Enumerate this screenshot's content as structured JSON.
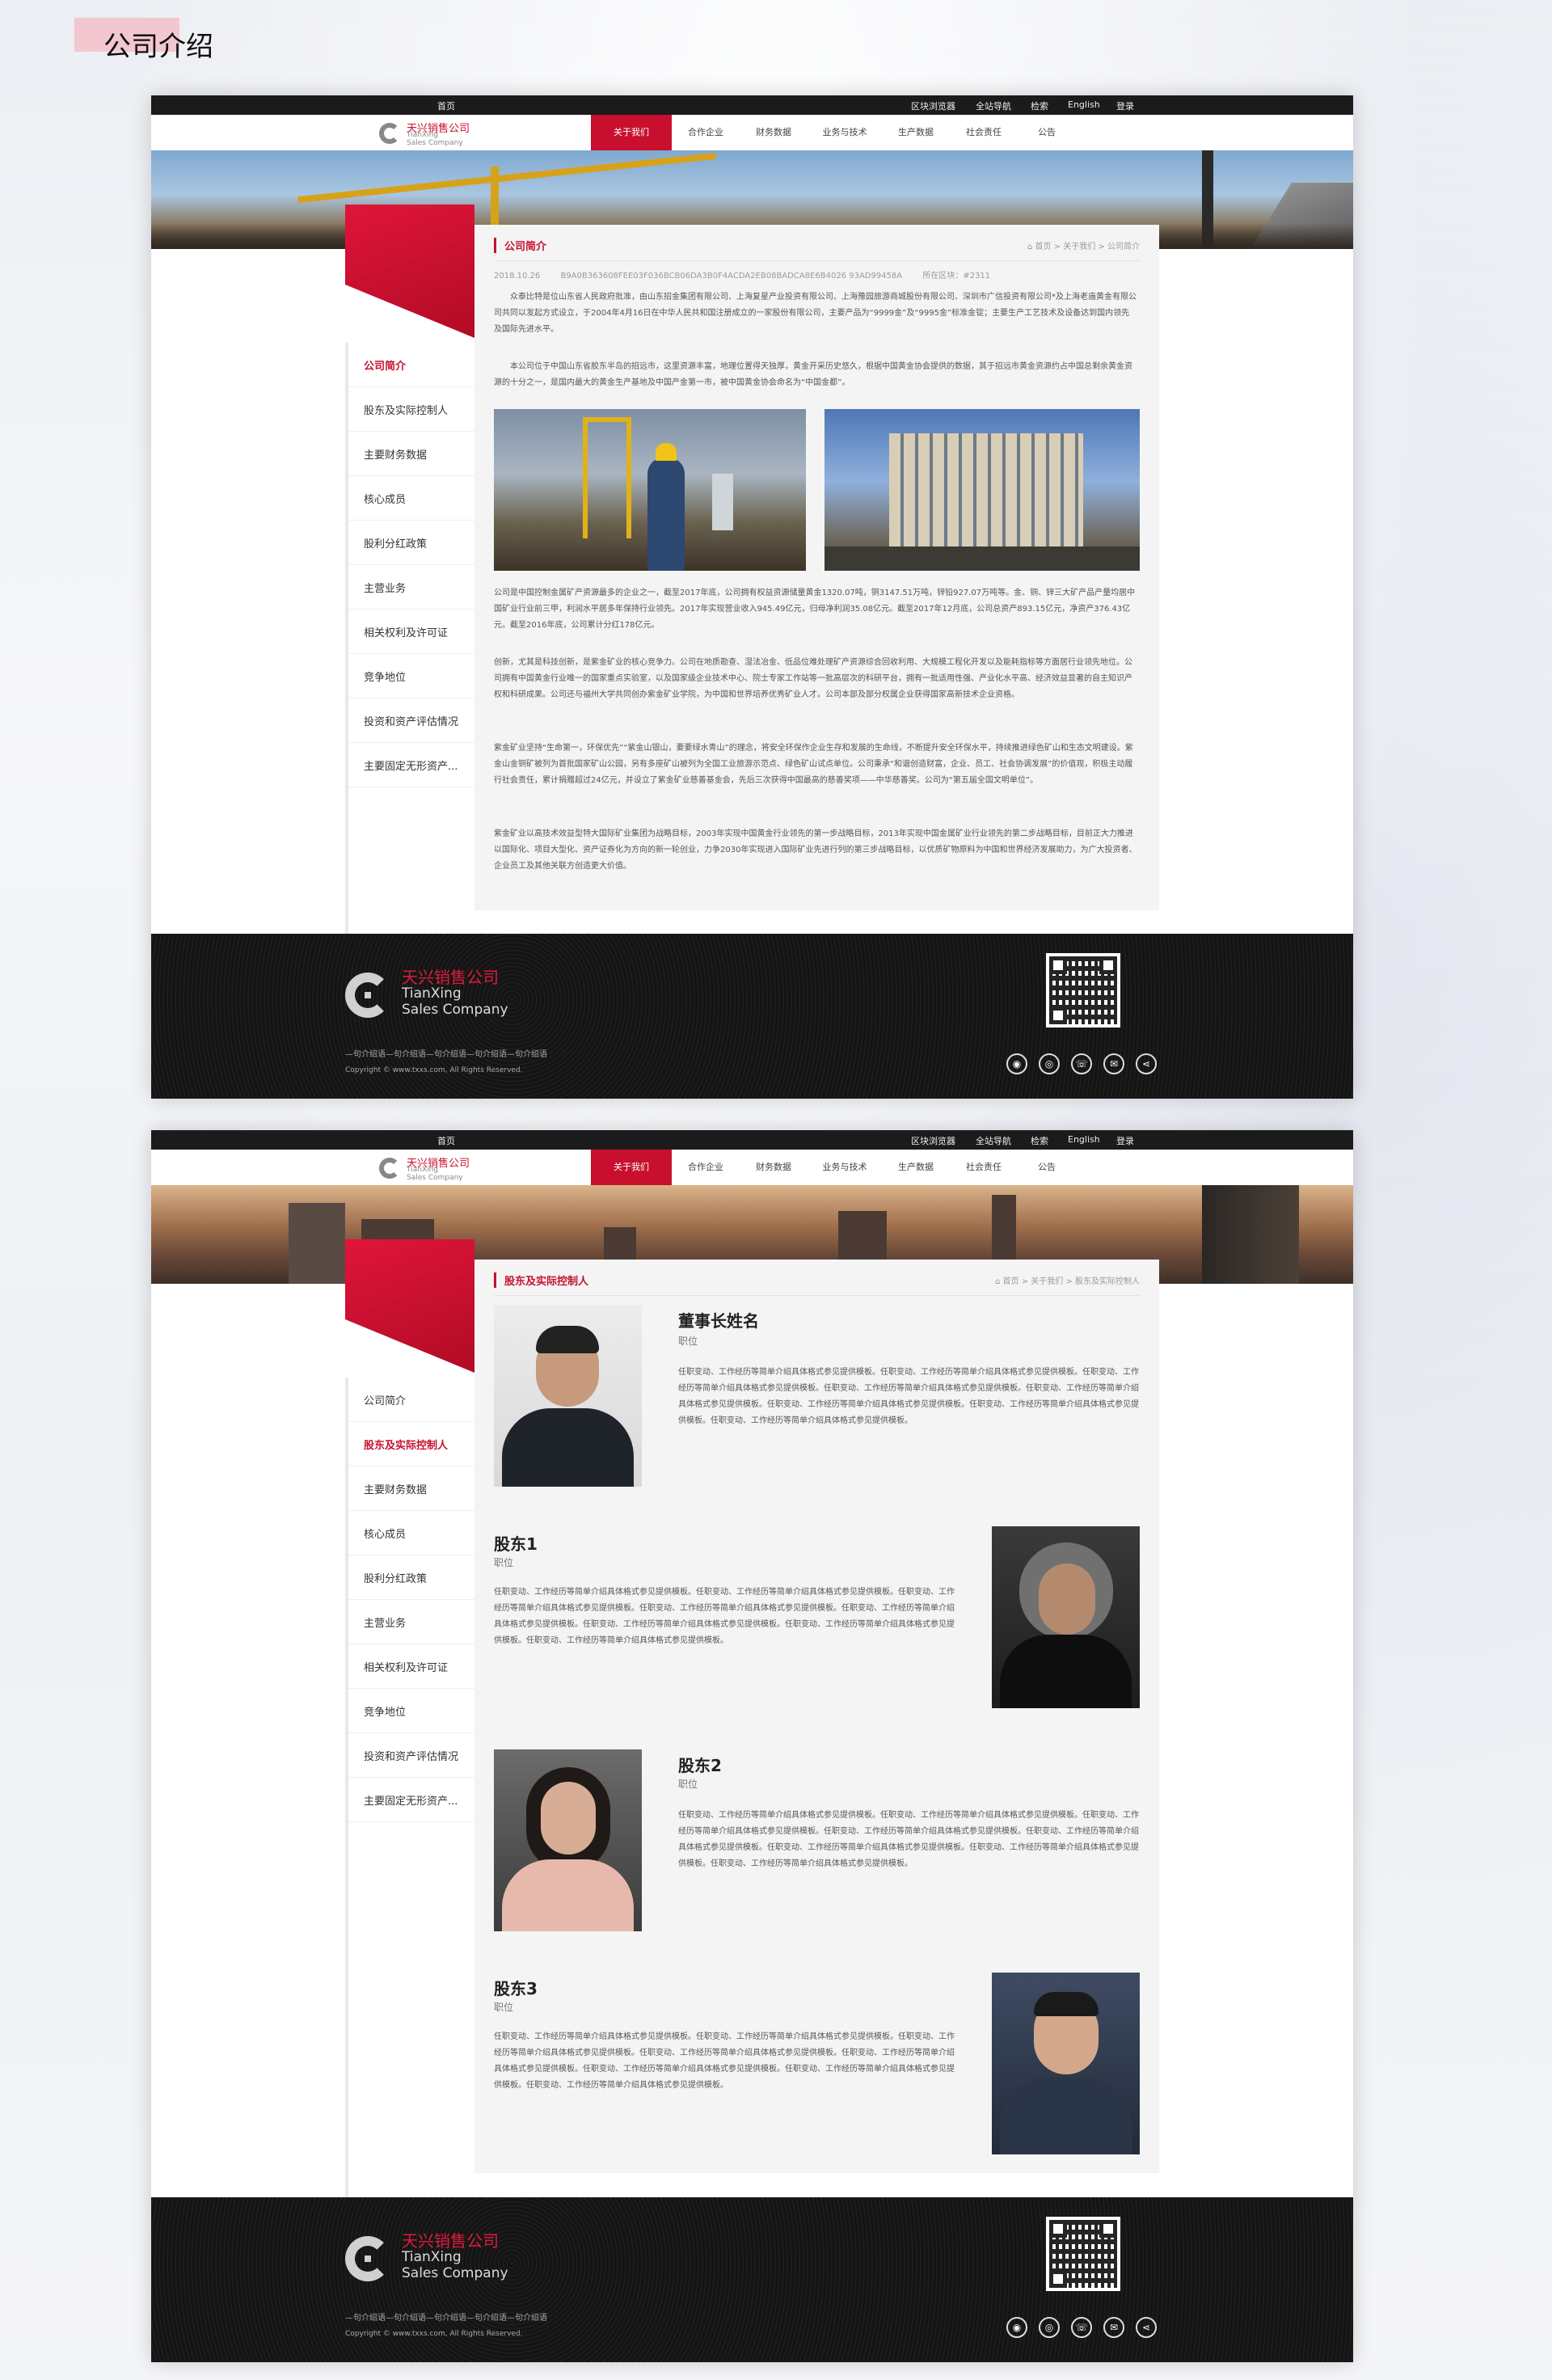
{
  "page_heading": "公司介绍",
  "header": {
    "top_links": [
      "首页",
      "区块浏览器",
      "全站导航",
      "检索",
      "English",
      "登录"
    ],
    "logo_cn": "天兴销售公司",
    "logo_en_1": "TianXing",
    "logo_en_2": "Sales Company",
    "nav": [
      "关于我们",
      "合作企业",
      "财务数据",
      "业务与技术",
      "生产数据",
      "社会责任",
      "公告"
    ]
  },
  "sidebar": [
    "公司简介",
    "股东及实际控制人",
    "主要财务数据",
    "核心成员",
    "股利分红政策",
    "主营业务",
    "相关权利及许可证",
    "竞争地位",
    "投资和资产评估情况",
    "主要固定无形资产..."
  ],
  "page1": {
    "section_title": "公司简介",
    "breadcrumb": "首页 > 关于我们 > 公司简介",
    "date": "2018.10.26",
    "hash": "B9A0B363608FEE03F036BCB06DA3B0F4ACDA2EB08BADCA8E6B4026 93AD99458A",
    "block": "所在区块：#2311",
    "p1": "众泰比特是位山东省人民政府批准，由山东招金集团有限公司、上海复星产业投资有限公司、上海豫园旅游商城股份有限公司、深圳市广信投资有限公司*及上海老庙黄金有限公司共同以发起方式设立，于2004年4月16日在中华人民共和国注册成立的一家股份有限公司，主要产品为“9999金”及“9995金”标准金锭；主要生产工艺技术及设备达到国内领先及国际先进水平。",
    "p2": "本公司位于中国山东省胶东半岛的招远市，这里资源丰富，地理位置得天独厚，黄金开采历史悠久，根据中国黄金协会提供的数据，其于招远市黄金资源约占中国总剩余黄金资源的十分之一，是国内最大的黄金生产基地及中国产金第一市，被中国黄金协会命名为“中国金都”。",
    "p3": "公司是中国控制金属矿产资源最多的企业之一，截至2017年底，公司拥有权益资源储量黄金1320.07吨，铜3147.51万吨，锌铅927.07万吨等。金、铜、锌三大矿产品产量均居中国矿业行业前三甲，利润水平居多年保持行业领先。2017年实现营业收入945.49亿元，归母净利润35.08亿元。截至2017年12月底，公司总资产893.15亿元，净资产376.43亿元。截至2016年底，公司累计分红178亿元。",
    "p4": "创新，尤其是科技创新，是紫金矿业的核心竞争力。公司在地质勘查、湿法冶金、低品位难处理矿产资源综合回收利用、大规模工程化开发以及能耗指标等方面居行业领先地位。公司拥有中国黄金行业唯一的国家重点实验室，以及国家级企业技术中心、院士专家工作站等一批高层次的科研平台，拥有一批适用性强、产业化水平高、经济效益显著的自主知识产权和科研成果。公司还与福州大学共同创办紫金矿业学院，为中国和世界培养优秀矿业人才。公司本部及部分权属企业获得国家高新技术企业资格。",
    "p5": "紫金矿业坚持“生命第一，环保优先”“紫金山银山，要要绿水青山”的理念，将安全环保作企业生存和发展的生命线，不断提升安全环保水平，持续推进绿色矿山和生态文明建设。紫金山金铜矿被列为首批国家矿山公园，另有多座矿山被列为全国工业旅游示范点、绿色矿山试点单位。公司秉承“和谐创造财富，企业、员工、社会协调发展”的价值观，积极主动履行社会责任，累计捐赠超过24亿元，并设立了紫金矿业慈善基金会，先后三次获得中国最高的慈善奖项——中华慈善奖。公司为“第五届全国文明单位”。",
    "p6": "紫金矿业以高技术效益型特大国际矿业集团为战略目标，2003年实现中国黄金行业领先的第一步战略目标，2013年实现中国金属矿业行业领先的第二步战略目标，目前正大力推进以国际化、项目大型化、资产证券化为方向的新一轮创业，力争2030年实现进入国际矿业先进行列的第三步战略目标，以优质矿物原料为中国和世界经济发展助力，为广大投资者、企业员工及其他关联方创造更大价值。"
  },
  "page2": {
    "section_title": "股东及实际控制人",
    "breadcrumb": "首页 > 关于我们 > 股东及实际控制人",
    "people": [
      {
        "name": "董事长姓名",
        "role": "职位",
        "desc": "任职变动、工作经历等简单介绍具体格式参见提供模板。任职变动、工作经历等简单介绍具体格式参见提供模板。任职变动、工作经历等简单介绍具体格式参见提供模板。任职变动、工作经历等简单介绍具体格式参见提供模板。任职变动、工作经历等简单介绍具体格式参见提供模板。任职变动、工作经历等简单介绍具体格式参见提供模板。任职变动、工作经历等简单介绍具体格式参见提供模板。任职变动、工作经历等简单介绍具体格式参见提供模板。"
      },
      {
        "name": "股东1",
        "role": "职位",
        "desc": "任职变动、工作经历等简单介绍具体格式参见提供模板。任职变动、工作经历等简单介绍具体格式参见提供模板。任职变动、工作经历等简单介绍具体格式参见提供模板。任职变动、工作经历等简单介绍具体格式参见提供模板。任职变动、工作经历等简单介绍具体格式参见提供模板。任职变动、工作经历等简单介绍具体格式参见提供模板。任职变动、工作经历等简单介绍具体格式参见提供模板。任职变动、工作经历等简单介绍具体格式参见提供模板。"
      },
      {
        "name": "股东2",
        "role": "职位",
        "desc": "任职变动、工作经历等简单介绍具体格式参见提供模板。任职变动、工作经历等简单介绍具体格式参见提供模板。任职变动、工作经历等简单介绍具体格式参见提供模板。任职变动、工作经历等简单介绍具体格式参见提供模板。任职变动、工作经历等简单介绍具体格式参见提供模板。任职变动、工作经历等简单介绍具体格式参见提供模板。任职变动、工作经历等简单介绍具体格式参见提供模板。任职变动、工作经历等简单介绍具体格式参见提供模板。"
      },
      {
        "name": "股东3",
        "role": "职位",
        "desc": "任职变动、工作经历等简单介绍具体格式参见提供模板。任职变动、工作经历等简单介绍具体格式参见提供模板。任职变动、工作经历等简单介绍具体格式参见提供模板。任职变动、工作经历等简单介绍具体格式参见提供模板。任职变动、工作经历等简单介绍具体格式参见提供模板。任职变动、工作经历等简单介绍具体格式参见提供模板。任职变动、工作经历等简单介绍具体格式参见提供模板。任职变动、工作经历等简单介绍具体格式参见提供模板。"
      }
    ]
  },
  "footer": {
    "logo_cn": "天兴销售公司",
    "logo_en_1": "TianXing",
    "logo_en_2": "Sales Company",
    "tagline": "—句介绍语—句介绍语—句介绍语—句介绍语—句介绍语",
    "copyright": "Copyright © www.txxs.com, All Rights Reserved.",
    "social_icons": [
      "wechat-icon",
      "weibo-icon",
      "phone-icon",
      "mail-icon",
      "share-icon"
    ]
  },
  "colors": {
    "accent": "#c8102e",
    "footer_bg": "#151515"
  }
}
